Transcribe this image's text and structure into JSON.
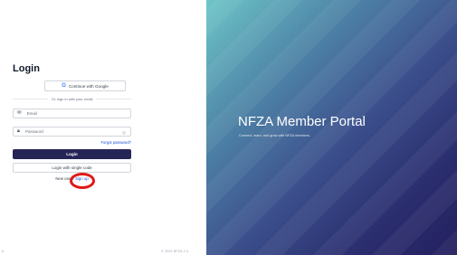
{
  "login": {
    "title": "Login",
    "google_button": "Continue with Google",
    "google_icon": "G",
    "divider_text": "Or, sign in with your email",
    "email_placeholder": "Email",
    "password_placeholder": "Password",
    "password_toggle": "◎",
    "forgot_password": "Forgot password?",
    "login_button": "Login",
    "sso_button": "Login with single code",
    "signup_prompt": "New user?",
    "signup_link": "Sign up"
  },
  "footer": {
    "left": "1",
    "right": "© 2025 NFZA 2.0"
  },
  "hero": {
    "title": "NFZA Member Portal",
    "subtitle": "Connect, learn, and grow with NFZA members."
  },
  "colors": {
    "primary": "#262558",
    "link": "#1d4ed8",
    "highlight": "#e01919"
  },
  "icons": {
    "google": "google-icon",
    "email": "envelope-icon",
    "password": "lock-icon",
    "toggle": "eye-icon"
  }
}
